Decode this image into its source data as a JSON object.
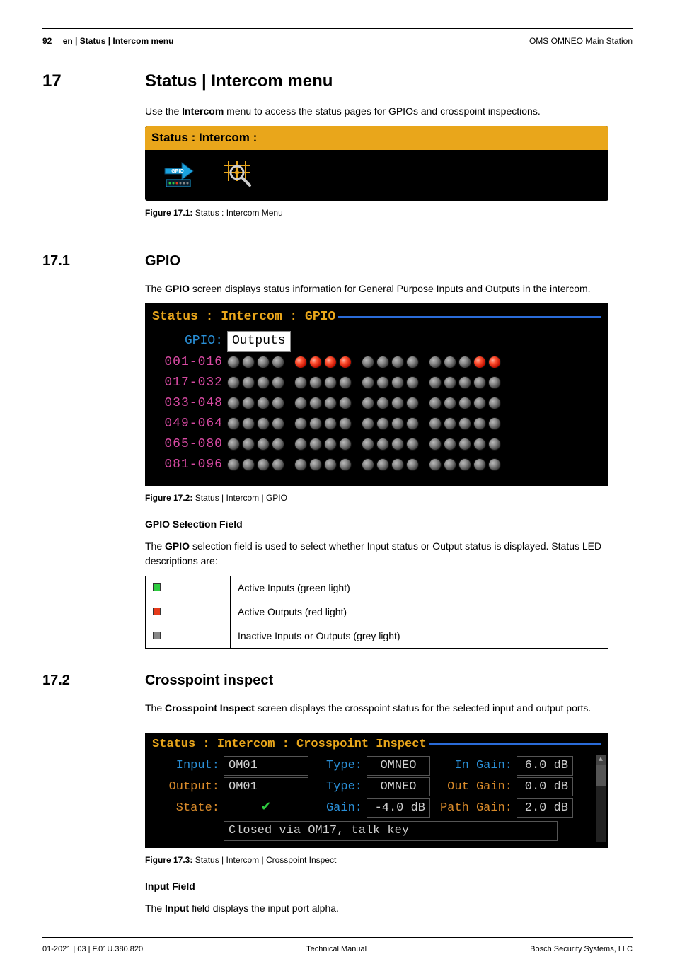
{
  "header": {
    "page_number": "92",
    "breadcrumb": "en | Status | Intercom menu",
    "product": "OMS OMNEO Main Station"
  },
  "sec17": {
    "num": "17",
    "title": "Status | Intercom menu",
    "intro_pre": "Use the ",
    "intro_bold": "Intercom",
    "intro_post": " menu to access the status pages for GPIOs and crosspoint inspections.",
    "fig1_title": "Status : Intercom :",
    "fig1_cap_b": "Figure 17.1: ",
    "fig1_cap": "Status : Intercom Menu"
  },
  "sec171": {
    "num": "17.1",
    "title": "GPIO",
    "p1_pre": "The ",
    "p1_bold": "GPIO",
    "p1_post": " screen displays status information for General Purpose Inputs and Outputs in the intercom.",
    "fig2_title": "Status : Intercom : GPIO",
    "gpio_label": "GPIO:",
    "gpio_value": "Outputs",
    "rows": [
      {
        "range": "001-016",
        "leds": "gggg rrrr gggg gggrr"
      },
      {
        "range": "017-032",
        "leds": "gggg gggg gggg ggggg"
      },
      {
        "range": "033-048",
        "leds": "gggg gggg gggg ggggg"
      },
      {
        "range": "049-064",
        "leds": "gggg gggg gggg ggggg"
      },
      {
        "range": "065-080",
        "leds": "gggg gggg gggg ggggg"
      },
      {
        "range": "081-096",
        "leds": "gggg gggg gggg ggggg"
      }
    ],
    "fig2_cap_b": "Figure 17.2: ",
    "fig2_cap": "Status | Intercom | GPIO",
    "gsf_title": "GPIO Selection Field",
    "gsf_p_pre": "The ",
    "gsf_p_bold": "GPIO",
    "gsf_p_post": " selection field is used to select whether Input status or Output status is displayed. Status LED descriptions are:",
    "table": [
      {
        "color": "green",
        "desc": "Active Inputs (green light)"
      },
      {
        "color": "red",
        "desc": "Active Outputs (red light)"
      },
      {
        "color": "grey",
        "desc": "Inactive Inputs or Outputs (grey light)"
      }
    ]
  },
  "sec172": {
    "num": "17.2",
    "title": "Crosspoint inspect",
    "p1_pre": "The ",
    "p1_bold": "Crosspoint Inspect",
    "p1_post": " screen displays the crosspoint status for the selected input and output ports.",
    "fig3_title": "Status : Intercom : Crosspoint Inspect",
    "labels": {
      "input": "Input:",
      "output": "Output:",
      "state": "State:",
      "type": "Type:",
      "gain": "Gain:",
      "in_gain": "In Gain:",
      "out_gain": "Out Gain:",
      "path_gain": "Path Gain:"
    },
    "values": {
      "input": "OM01",
      "output": "OM01",
      "type1": "OMNEO",
      "type2": "OMNEO",
      "in_gain": "6.0 dB",
      "out_gain": "0.0 dB",
      "gain": "-4.0 dB",
      "path_gain": "2.0 dB",
      "closed": "Closed via OM17, talk key"
    },
    "fig3_cap_b": "Figure 17.3: ",
    "fig3_cap": "Status | Intercom | Crosspoint Inspect",
    "inputfield_title": "Input Field",
    "inputfield_p_pre": "The ",
    "inputfield_p_bold": "Input",
    "inputfield_p_post": " field displays the input port alpha."
  },
  "footer": {
    "left": "01-2021 | 03 | F.01U.380.820",
    "center": "Technical Manual",
    "right": "Bosch Security Systems, LLC"
  }
}
